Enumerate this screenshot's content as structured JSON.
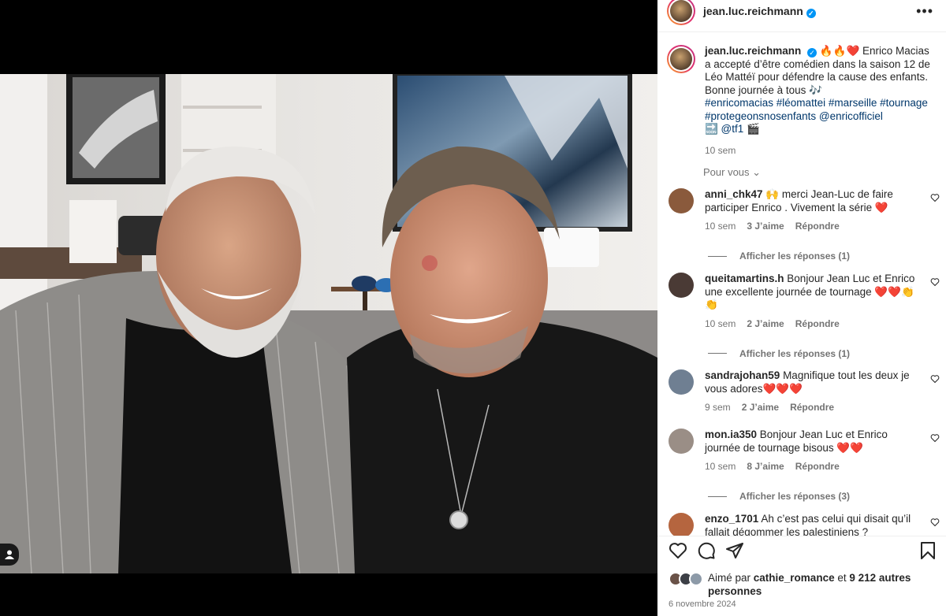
{
  "post": {
    "username": "jean.luc.reichmann",
    "verified_mark": "✓",
    "more_label": "•••",
    "caption_emojis": "🔥🔥❤️",
    "caption_text": "Enrico Macias a accepté d’être comédien dans la saison 12 de Léo Mattéï pour défendre la cause des enfants. Bonne journée à tous 🎶",
    "hashtags": "#enricomacias #léomattei #marseille #tournage #protegeonsnosenfants @enricofficiel",
    "mention_line": "🔜 @tf1 🎬",
    "time": "10 sem"
  },
  "for_you_label": "Pour vous ⌄",
  "comments": [
    {
      "user": "anni_chk47",
      "text": "🙌 merci Jean-Luc de faire participer Enrico . Vivement la série ❤️",
      "time": "10 sem",
      "likes": "3 J’aime",
      "reply": "Répondre",
      "replies": "Afficher les réponses (1)",
      "avatar_color": "#8a5a3c"
    },
    {
      "user": "queitamartins.h",
      "text": "Bonjour Jean Luc et Enrico une excellente journée de tournage ❤️❤️👏👏",
      "time": "10 sem",
      "likes": "2 J’aime",
      "reply": "Répondre",
      "replies": "Afficher les réponses (1)",
      "avatar_color": "#4a3a35"
    },
    {
      "user": "sandrajohan59",
      "text": "Magnifique tout les deux je vous adores❤️❤️❤️",
      "time": "9 sem",
      "likes": "2 J’aime",
      "reply": "Répondre",
      "replies": "",
      "avatar_color": "#6f7f92"
    },
    {
      "user": "mon.ia350",
      "text": "Bonjour Jean Luc et Enrico journée de tournage bisous ❤️❤️",
      "time": "10 sem",
      "likes": "8 J’aime",
      "reply": "Répondre",
      "replies": "Afficher les réponses (3)",
      "avatar_color": "#9a8e86"
    },
    {
      "user": "enzo_1701",
      "text": "Ah c’est pas celui qui disait qu’il fallait dégommer les palestiniens ?",
      "time": "",
      "likes": "",
      "reply": "",
      "replies": "",
      "avatar_color": "#b5653f"
    }
  ],
  "likes_line": {
    "prefix": "Aimé par ",
    "user": "cathie_romance",
    "middle": " et ",
    "count": "9 212 autres personnes"
  },
  "date": "6 novembre 2024",
  "colors": {
    "verified": "#0095f6",
    "link": "#00376b",
    "muted": "#737373"
  }
}
